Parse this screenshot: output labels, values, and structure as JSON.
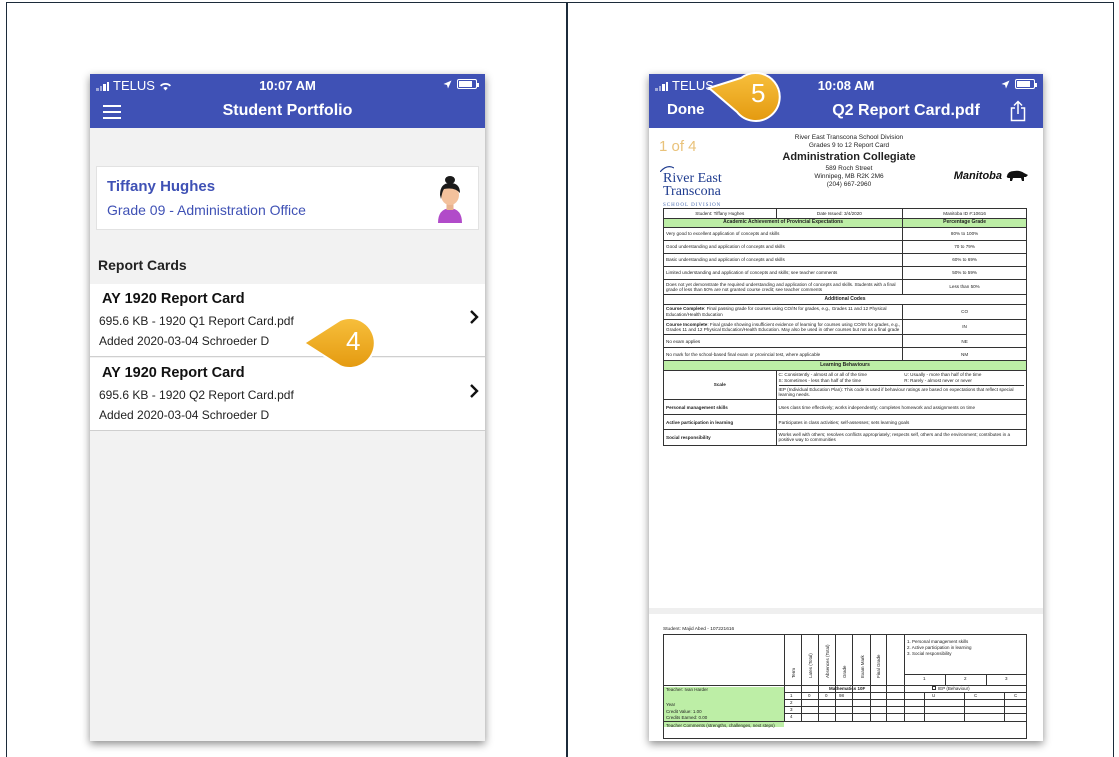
{
  "left_phone": {
    "status": {
      "carrier": "TELUS",
      "time": "10:07 AM"
    },
    "nav": {
      "title": "Student Portfolio",
      "menu_icon": "hamburger-icon"
    },
    "student": {
      "name": "Tiffany Hughes",
      "grade": "Grade 09 - Administration Office",
      "avatar_icon": "avatar-icon"
    },
    "section": {
      "title": "Report Cards"
    },
    "report_cards": [
      {
        "title": "AY  1920  Report Card",
        "file": "695.6  KB  - 1920 Q1 Report Card.pdf",
        "added": "Added  2020-03-04  Schroeder D"
      },
      {
        "title": "AY  1920  Report Card",
        "file": "695.6  KB  - 1920 Q2 Report Card.pdf",
        "added": "Added  2020-03-04  Schroeder D"
      }
    ],
    "callout": "4"
  },
  "right_phone": {
    "status": {
      "carrier": "TELUS",
      "time": "10:08 AM"
    },
    "nav": {
      "done": "Done",
      "title": "Q2 Report Card.pdf",
      "share_icon": "share-icon"
    },
    "callout": "5",
    "doc": {
      "page_indicator": "1 of 4",
      "logo_line1": "River East",
      "logo_line2": "Transcona",
      "logo_small": "SCHOOL DIVISION",
      "division": "River East Transcona School Division",
      "subtitle": "Grades 9 to 12 Report Card",
      "school": "Administration Collegiate",
      "address1": "589 Roch Street",
      "address2": "Winnipeg, MB R2K 2M6",
      "phone": "(204) 667-2960",
      "province": "Manitoba",
      "student_cell": "Student: Tiffany Hughes",
      "date_cell": "Date Issued: 3/4/2020",
      "mb_id": "Manitoba ID #:10616",
      "academic_header": "Academic Achievement of Provincial Expectations",
      "pct_header": "Percentage Grade",
      "academic_rows": [
        {
          "desc": "Very good to excellent application of concepts and skills",
          "pct": "80% to 100%"
        },
        {
          "desc": "Good understanding and application of concepts and skills",
          "pct": "70 to 79%"
        },
        {
          "desc": "Basic understanding and application of concepts and skills",
          "pct": "60% to 69%"
        },
        {
          "desc": "Limited understanding and application of concepts and skills; see teacher comments",
          "pct": "50% to 59%"
        },
        {
          "desc": "Does not yet demonstrate the required understanding and application of concepts and skills. Students with a final grade of less than 50% are not granted course credit; see teacher comments",
          "pct": "Less than 50%"
        }
      ],
      "additional_header": "Additional Codes",
      "codes": [
        {
          "bold": "Course Complete",
          "desc": ": Final passing grade for courses using CO/IN for grades, e.g., Grades 11 and 12 Physical Education/Health Education",
          "code": "CO"
        },
        {
          "bold": "Course Incomplete",
          "desc": ": Final grade showing insufficient evidence of learning for courses using CO/IN for grades, e.g., Grades 11 and 12 Physical Education/Health Education. May also be used in other courses but not as a final grade",
          "code": "IN"
        },
        {
          "bold": "",
          "desc": "No exam applies",
          "code": "NE"
        },
        {
          "bold": "",
          "desc": "No mark for the school-based final exam or provincial test, where applicable",
          "code": "NM"
        }
      ],
      "behaviour_header": "Learning Behaviours",
      "scale_label": "Scale",
      "scale_c": "C: Consistently - almost all or all of the time",
      "scale_s": "S: Sometimes - less than half of the time",
      "scale_u": "U: Usually - more than half of the time",
      "scale_r": "R: Rarely - almost never or never",
      "scale_iep": "IEP (Individual Education Plan): This code is used if behaviour ratings are based on expectations that reflect special learning needs.",
      "behaviours": [
        {
          "name": "Personal management skills",
          "desc": "Uses class time effectively; works independently; completes homework and assignments on time"
        },
        {
          "name": "Active participation in learning",
          "desc": "Participates in class activities; self-assesses; sets learning goals"
        },
        {
          "name": "Social responsibility",
          "desc": "Works well with others; resolves conflicts appropriately; respects self, others and the environment; contributes in a positive way to communities"
        }
      ],
      "page2": {
        "student": "Student: Majid Abed - 107221616",
        "col_heads": [
          "Term",
          "Lates (Total)",
          "Absences (Total)",
          "Grade",
          "Exam Mark",
          "Final Grade"
        ],
        "legend": [
          "1. Personal management skills",
          "2. Active participation in learning",
          "3. Social responsibility"
        ],
        "legend_nums": [
          "1",
          "2",
          "3"
        ],
        "teacher": "Teacher: Ivan Harder",
        "course": "Mathematics 10F",
        "iep": "IEP (Behaviour)",
        "year": "Year",
        "credit_value": "Credit Value: 1.00",
        "credits_earned": "Credits Earned: 0.00",
        "terms": [
          "1",
          "2",
          "3",
          "4"
        ],
        "term1": [
          "0",
          "0",
          "98"
        ],
        "behaviour_marks": [
          "U",
          "C",
          "C"
        ],
        "comments": "Teacher Comments (strengths, challenges, next steps)"
      }
    }
  }
}
